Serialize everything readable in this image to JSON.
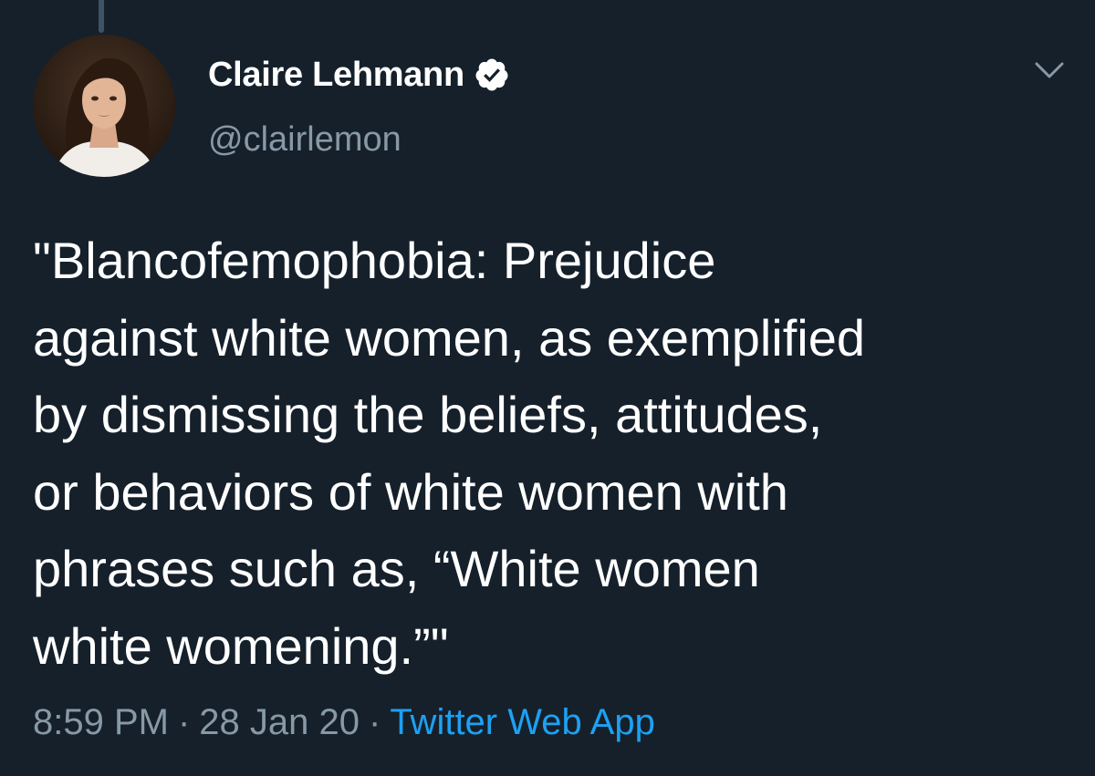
{
  "tweet": {
    "display_name": "Claire Lehmann",
    "handle": "@clairlemon",
    "verified": true,
    "text_lines": [
      "\"Blancofemophobia: Prejudice",
      "against white women, as exemplified",
      "by dismissing the beliefs, attitudes,",
      "or behaviors of white women with",
      "phrases such as, “White women",
      "white womening.”\""
    ],
    "time": "8:59 PM",
    "date": "28 Jan 20",
    "separator": "·",
    "source": "Twitter Web App"
  },
  "icons": {
    "verified": "verified-badge-icon",
    "menu": "chevron-down-icon"
  },
  "colors": {
    "background": "#15202b",
    "primary_text": "#ffffff",
    "secondary_text": "#8899a6",
    "link": "#1da1f2"
  }
}
